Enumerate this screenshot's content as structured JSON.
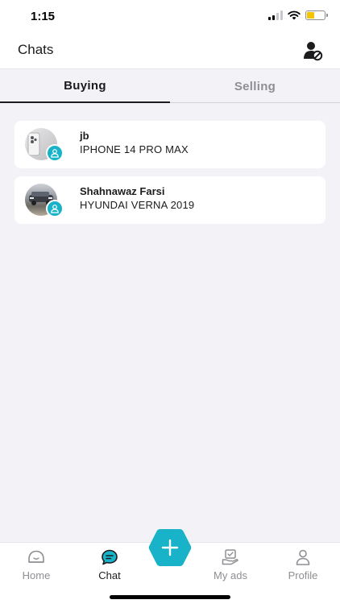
{
  "status_bar": {
    "time": "1:15"
  },
  "header": {
    "title": "Chats",
    "block_icon": "person-block-icon"
  },
  "tabs": [
    {
      "label": "Buying",
      "active": true
    },
    {
      "label": "Selling",
      "active": false
    }
  ],
  "chats": [
    {
      "name": "jb",
      "title": "IPHONE 14 PRO MAX",
      "avatar": "phone-photo"
    },
    {
      "name": "Shahnawaz Farsi",
      "title": "HYUNDAI VERNA 2019",
      "avatar": "car-photo"
    }
  ],
  "bottom_nav": {
    "items": [
      {
        "label": "Home",
        "icon": "home-icon",
        "active": false
      },
      {
        "label": "Chat",
        "icon": "chat-icon",
        "active": true
      },
      {
        "label": "My ads",
        "icon": "my-ads-icon",
        "active": false
      },
      {
        "label": "Profile",
        "icon": "profile-icon",
        "active": false
      }
    ],
    "fab_icon": "plus-icon"
  },
  "colors": {
    "accent": "#19b3c9",
    "background": "#f2f2f7",
    "card": "#ffffff",
    "inactive_text": "#8e8e93"
  }
}
